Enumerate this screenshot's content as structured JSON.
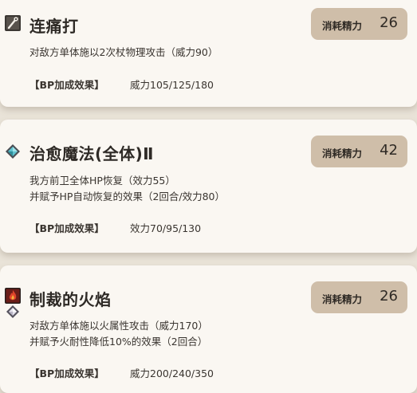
{
  "skills": [
    {
      "name": "连痛打",
      "icon": "staff-strike-icon",
      "cost_label": "消耗精力",
      "cost_value": "26",
      "description": [
        "对敌方单体施以2次杖物理攻击（威力90）"
      ],
      "bp_label": "【BP加成效果】",
      "bp_value": "威力105/125/180"
    },
    {
      "name": "治愈魔法(全体)Ⅱ",
      "icon": "healing-crystal-icon",
      "cost_label": "消耗精力",
      "cost_value": "42",
      "description": [
        "我方前卫全体HP恢复（效力55）",
        "并赋予HP自动恢复的效果（2回合/效力80）"
      ],
      "bp_label": "【BP加成效果】",
      "bp_value": "效力70/95/130"
    },
    {
      "name": "制裁的火焰",
      "icon": "fire-attack-icon",
      "cost_label": "消耗精力",
      "cost_value": "26",
      "description": [
        "对敌方单体施以火属性攻击（威力170）",
        "并赋予火耐性降低10%的效果（2回合）"
      ],
      "bp_label": "【BP加成效果】",
      "bp_value": "威力200/240/350"
    }
  ],
  "colors": {
    "background": "#e9e3d8",
    "card": "#faf7f2",
    "cost_badge": "#cfbea9",
    "text": "#3a3530"
  }
}
